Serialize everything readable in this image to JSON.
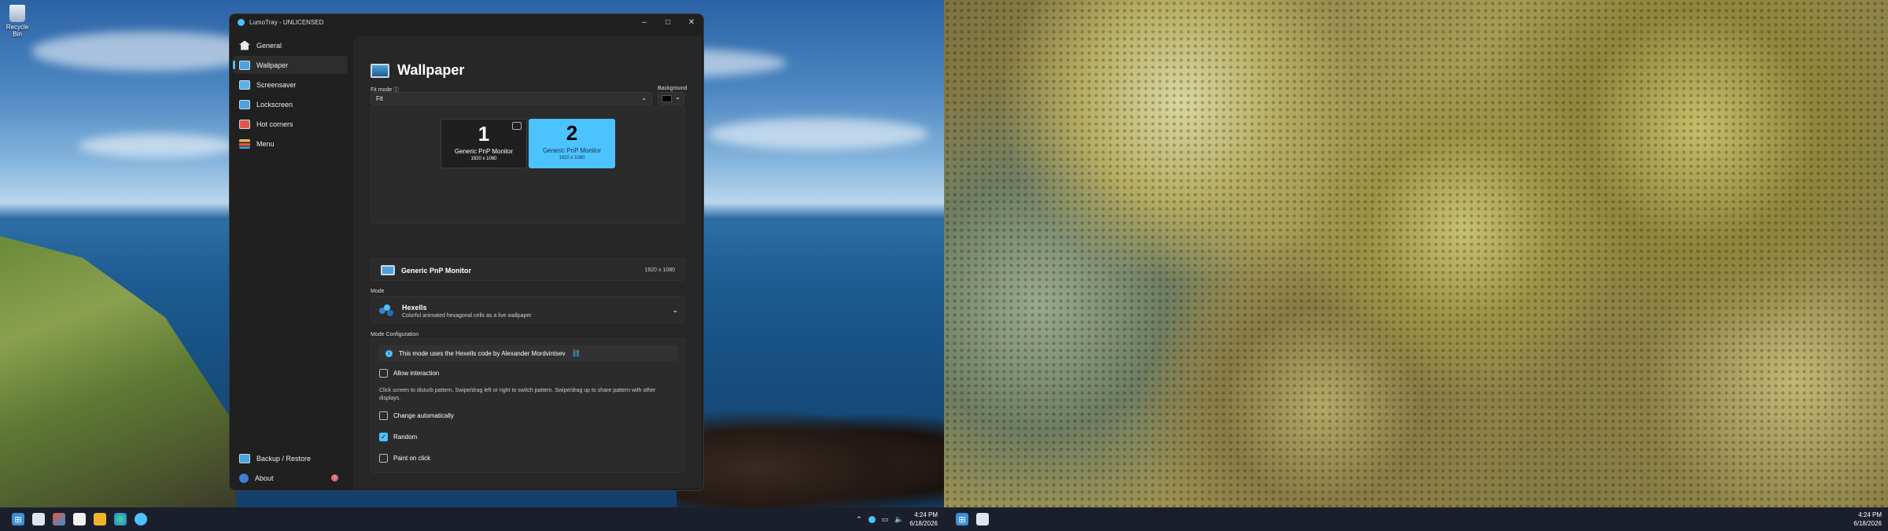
{
  "desktop": {
    "recycle_bin_label": "Recycle Bin"
  },
  "window": {
    "title": "LumoTray - UNLICENSED",
    "buttons": {
      "minimize": "–",
      "maximize": "□",
      "close": "✕"
    }
  },
  "sidebar": {
    "items": [
      {
        "label": "General",
        "icon": "home-icon",
        "color": "#e8e8e8"
      },
      {
        "label": "Wallpaper",
        "icon": "wallpaper-icon",
        "color": "#4aa3df"
      },
      {
        "label": "Screensaver",
        "icon": "screensaver-icon",
        "color": "#5ab0e8"
      },
      {
        "label": "Lockscreen",
        "icon": "lockscreen-icon",
        "color": "#4aa3df"
      },
      {
        "label": "Hot corners",
        "icon": "hot-corners-icon",
        "color": "#e0584a"
      },
      {
        "label": "Menu",
        "icon": "menu-icon",
        "color": "#e9b94a"
      }
    ],
    "bottom": [
      {
        "label": "Backup / Restore",
        "icon": "backup-icon"
      },
      {
        "label": "About",
        "icon": "about-icon",
        "badge": "!"
      }
    ]
  },
  "page": {
    "title": "Wallpaper",
    "fit_mode_label": "Fit mode",
    "fit_mode_value": "Fit",
    "background_label": "Background",
    "background_color": "#000000"
  },
  "monitors": [
    {
      "number": "1",
      "name": "Generic PnP Monitor",
      "resolution": "1920 x 1080",
      "selected": false
    },
    {
      "number": "2",
      "name": "Generic PnP Monitor",
      "resolution": "1920 x 1080",
      "selected": true
    }
  ],
  "selected_monitor": {
    "name": "Generic PnP Monitor",
    "resolution": "1920 x 1080"
  },
  "mode": {
    "label": "Mode",
    "title": "Hexells",
    "subtitle": "Colorful animated hexagonal cells as a live wallpaper"
  },
  "config": {
    "label": "Mode Configuration",
    "info": "This mode uses the Hexells code by Alexander Mordvintsev",
    "allow_interaction": "Allow interaction",
    "hint": "Click screen to disturb pattern. Swipe/drag left or right to switch pattern. Swipe/drag up to share pattern with other displays.",
    "change_automatically": "Change automatically",
    "random": "Random",
    "paint_on_click": "Paint on click",
    "allow_interaction_checked": false,
    "change_automatically_checked": false,
    "random_checked": true,
    "paint_on_click_checked": false
  },
  "taskbar": {
    "time": "4:24 PM",
    "date": "6/18/2026",
    "accent": "#4cc2ff"
  }
}
